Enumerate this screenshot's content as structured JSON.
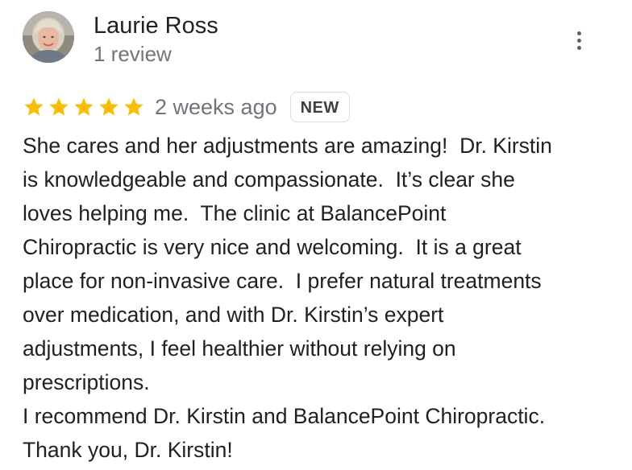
{
  "reviewer": {
    "name": "Laurie Ross",
    "review_count": "1 review",
    "avatar_icon": "person-photo"
  },
  "menu": {
    "icon": "more-vert-icon"
  },
  "review": {
    "rating": 5,
    "rating_max": 5,
    "star_color": "#fbbc04",
    "date": "2 weeks ago",
    "badge": "NEW",
    "text_lines": [
      "She cares and her adjustments are amazing!  Dr. Kirstin",
      "is knowledgeable and compassionate.  It’s clear she",
      "loves helping me.  The clinic at BalancePoint",
      "Chiropractic is very nice and welcoming.  It is a great",
      "place for non-invasive care.  I prefer natural treatments",
      "over medication, and with Dr. Kirstin’s expert",
      "adjustments, I feel healthier without relying on",
      "prescriptions.",
      "I recommend Dr. Kirstin and BalancePoint Chiropractic.",
      "Thank you, Dr. Kirstin!"
    ]
  }
}
